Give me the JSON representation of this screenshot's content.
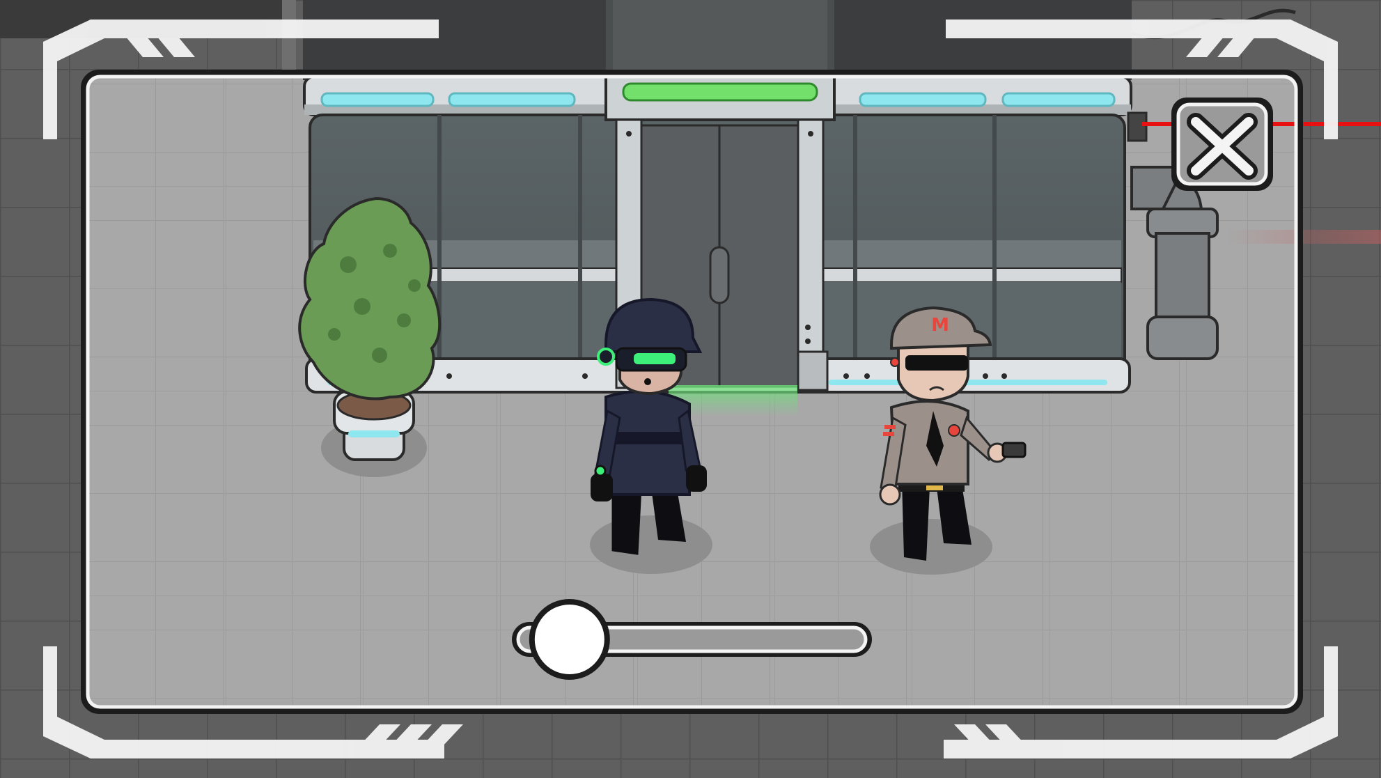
{
  "colors": {
    "floor_outer": "#5d5d5d",
    "floor_inner": "#a9a9a9",
    "tile_line_inner": "#9a9a9a",
    "frame_white": "#f4f4f4",
    "frame_dark": "#1c1c1c",
    "building_dark": "#3d3f40",
    "building_mid": "#4c5254",
    "glass": "#5e6669",
    "light_cyan": "#8ee6ee",
    "light_green": "#72e06a",
    "laser_red": "#e81010",
    "bush_green": "#6a9c55",
    "bush_dark": "#4e7c3f",
    "suit_navy": "#2b2f45",
    "visor_green": "#3cf07a",
    "guard_khaki": "#9c918a",
    "guard_cap_m": "#e8463c"
  },
  "icons": {
    "close": "close-x-icon",
    "guard_cap_emblem": "M"
  },
  "controls": {
    "slider_level": 0.08
  }
}
